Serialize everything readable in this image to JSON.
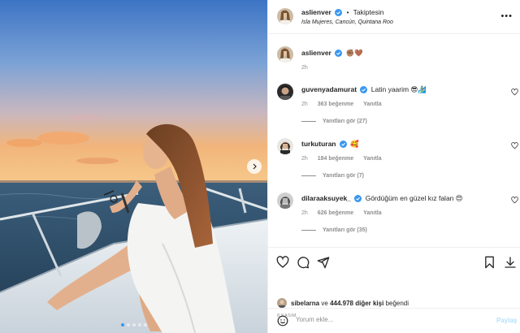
{
  "post": {
    "author": "aslienver",
    "follow_status": "Takiptesin",
    "separator": "•",
    "location": "Isla Mujeres, Cancún, Quintana Roo",
    "caption_emojis": "✊🏽🤎",
    "caption_time": "2h",
    "carousel_dots": 5,
    "active_dot": 1
  },
  "comments": [
    {
      "username": "guvenyadamurat",
      "text": "Latin yaarim 😎🏄🏽‍♂️",
      "time": "2h",
      "likes": "363 beğenme",
      "reply_label": "Yanıtla",
      "view_replies": "Yanıtları gör (27)"
    },
    {
      "username": "turkuturan",
      "text": "🥰",
      "time": "2h",
      "likes": "184 beğenme",
      "reply_label": "Yanıtla",
      "view_replies": "Yanıtları gör (7)"
    },
    {
      "username": "dilaraaksuyek_",
      "text": "Gördüğüm en güzel kız falan 😍",
      "time": "2h",
      "likes": "626 beğenme",
      "reply_label": "Yanıtla",
      "view_replies": "Yanıtları gör (35)"
    }
  ],
  "likes": {
    "liker": "sibelarna",
    "connector": "ve",
    "others": "444.978 diğer kişi",
    "suffix": "beğendi"
  },
  "date": "8 KASIM",
  "comment_box": {
    "placeholder": "Yorum ekle...",
    "post_label": "Paylaş"
  },
  "icons": {
    "verified": "verified-badge-icon",
    "like": "heart-outline-icon",
    "comment": "comment-bubble-icon",
    "share": "paper-plane-icon",
    "save": "bookmark-icon",
    "download": "download-icon",
    "emoji": "smiley-icon",
    "more": "more-horizontal-icon",
    "next": "chevron-right-icon"
  },
  "colors": {
    "verified_blue": "#3897f0",
    "muted_text": "#8e8e8e",
    "post_button_disabled": "#b2dffc",
    "border": "#efefef"
  }
}
